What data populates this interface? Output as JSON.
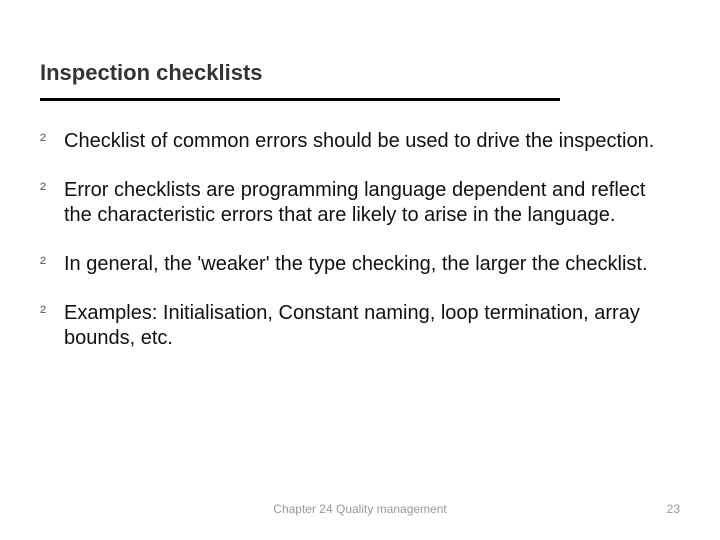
{
  "slide": {
    "title": "Inspection checklists",
    "bullets": [
      "Checklist of common errors should be used to drive the inspection.",
      "Error checklists are programming language dependent and reflect the characteristic errors that are likely to arise in the language.",
      "In general, the 'weaker' the type checking, the larger the checklist.",
      "Examples: Initialisation, Constant naming, loop termination, array bounds, etc."
    ],
    "bullet_marker": "²",
    "footer_center": "Chapter 24 Quality management",
    "page_number": "23"
  }
}
